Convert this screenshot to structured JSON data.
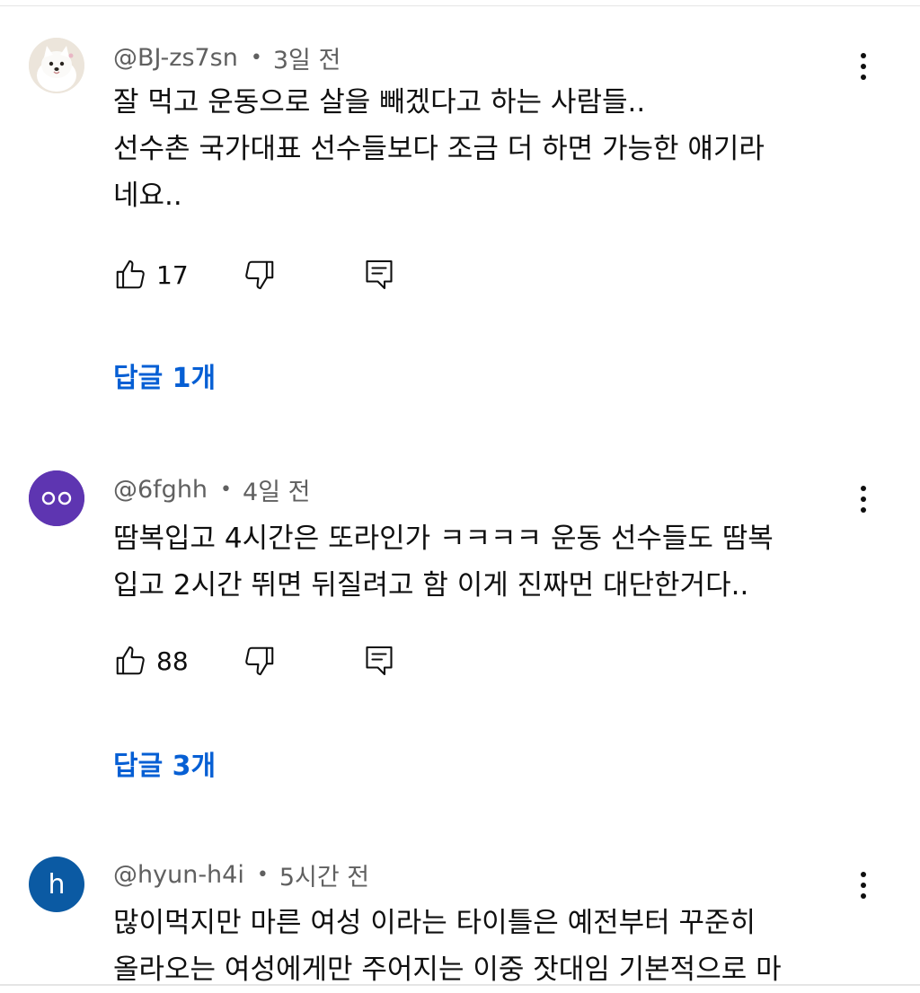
{
  "comments": [
    {
      "author": "@BJ-zs7sn",
      "time": "3일 전",
      "avatar": {
        "type": "image",
        "icon": "dog-avatar-icon"
      },
      "text": "잘 먹고 운동으로 살을 빼겠다고 하는 사람들..\n선수촌 국가대표 선수들보다 조금 더 하면 가능한 얘기라\n네요..",
      "likes": "17",
      "replies": "답글 1개"
    },
    {
      "author": "@6fghh",
      "time": "4일 전",
      "avatar": {
        "type": "eyes",
        "icon": "eyes-avatar-icon",
        "color": "#5e35b1"
      },
      "text": "땀복입고 4시간은 또라인가 ㅋㅋㅋㅋ 운동 선수들도 땀복\n입고 2시간 뛰면 뒤질려고 함 이게 진짜먼 대단한거다..",
      "likes": "88",
      "replies": "답글 3개"
    },
    {
      "author": "@hyun-h4i",
      "time": "5시간 전",
      "avatar": {
        "type": "letter",
        "letter": "h",
        "color": "#0b5aa3"
      },
      "text": "많이먹지만 마른 여성 이라는 타이틀은 예전부터 꾸준히\n올라오는 여성에게만 주어지는 이중 잣대임 기본적으로 마",
      "likes": "",
      "replies": ""
    }
  ],
  "icons": {
    "like": "thumbs-up-icon",
    "dislike": "thumbs-down-icon",
    "reply": "comment-reply-icon",
    "menu": "more-vertical-icon"
  },
  "colors": {
    "link": "#065fd4",
    "meta": "#606060",
    "text": "#0f0f0f"
  }
}
